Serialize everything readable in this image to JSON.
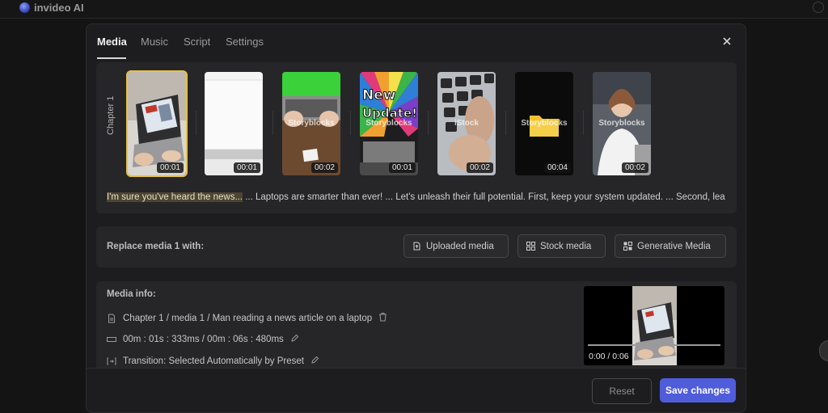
{
  "app": {
    "title": "invideo AI"
  },
  "modal": {
    "tabs": [
      {
        "label": "Media"
      },
      {
        "label": "Music"
      },
      {
        "label": "Script"
      },
      {
        "label": "Settings"
      }
    ],
    "active_tab": "Media",
    "close_icon": "close-icon"
  },
  "media_strip": {
    "chapter_label": "Chapter 1",
    "clips": [
      {
        "source": "",
        "duration": "00:01",
        "selected": true
      },
      {
        "source": "",
        "duration": "00:01",
        "selected": false
      },
      {
        "source": "Storyblocks",
        "duration": "00:02",
        "selected": false
      },
      {
        "source": "Storyblocks",
        "duration": "00:01",
        "selected": false
      },
      {
        "source": "iStock",
        "duration": "00:02",
        "selected": false
      },
      {
        "source": "Storyblocks",
        "duration": "00:04",
        "selected": false
      },
      {
        "source": "Storyblocks",
        "duration": "00:02",
        "selected": false
      }
    ],
    "script_highlight": "I'm sure you've heard the news...",
    "script_rest": " ... Laptops are smarter than ever! ... Let's unleash their full potential. First, keep your system updated. ... Second, lea"
  },
  "replace": {
    "label": "Replace media 1 with:",
    "buttons": [
      {
        "label": "Uploaded media",
        "icon": "upload-file-icon"
      },
      {
        "label": "Stock media",
        "icon": "stock-grid-icon"
      },
      {
        "label": "Generative Media",
        "icon": "generate-grid-icon"
      }
    ]
  },
  "media_info": {
    "title": "Media info:",
    "path": "Chapter 1 / media 1 / Man reading a news article on a laptop",
    "timing": "00m : 01s : 333ms / 00m : 06s : 480ms",
    "transition": "Transition: Selected Automatically by Preset",
    "preview_time": "0:00 / 0:06"
  },
  "footer": {
    "reset_label": "Reset",
    "save_label": "Save changes"
  },
  "colors": {
    "accent": "#4f5ddb",
    "selected_outline": "#e5c14a",
    "highlight": "#4b4531"
  }
}
